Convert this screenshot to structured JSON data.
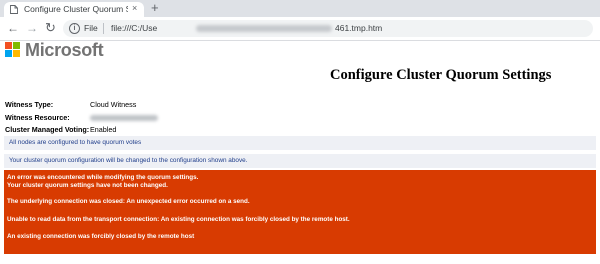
{
  "browser": {
    "tab_title": "Configure Cluster Quorum Setti",
    "tab_close_glyph": "×",
    "new_tab_glyph": "+",
    "address": {
      "scheme_label": "File",
      "url_start": "file:///C:/Use",
      "url_end": "461.tmp.htm"
    }
  },
  "header": {
    "brand": "Microsoft",
    "page_title": "Configure Cluster Quorum Settings"
  },
  "settings": {
    "witness_type_label": "Witness Type:",
    "witness_type_value": "Cloud Witness",
    "witness_resource_label": "Witness Resource:",
    "managed_voting_label": "Cluster Managed Voting:",
    "managed_voting_value": "Enabled"
  },
  "notices": {
    "nodes": "All nodes are configured to have quorum votes",
    "change": "Your cluster quorum configuration will be changed to the configuration shown above."
  },
  "error": {
    "line1": "An error was encountered while modifying the quorum settings.",
    "line2": "Your cluster quorum settings have not been changed.",
    "line3": "The underlying connection was closed: An unexpected error occurred on a send.",
    "line4": "Unable to read data from the transport connection: An existing connection was forcibly closed by the remote host.",
    "line5": "An existing connection was forcibly closed by the remote host"
  },
  "colors": {
    "error_bg": "#d83b01",
    "band_bg": "#eef0f5",
    "band_text": "#1f3d8a",
    "logo_red": "#f25022",
    "logo_green": "#7fba00",
    "logo_blue": "#00a4ef",
    "logo_yellow": "#ffb900"
  }
}
